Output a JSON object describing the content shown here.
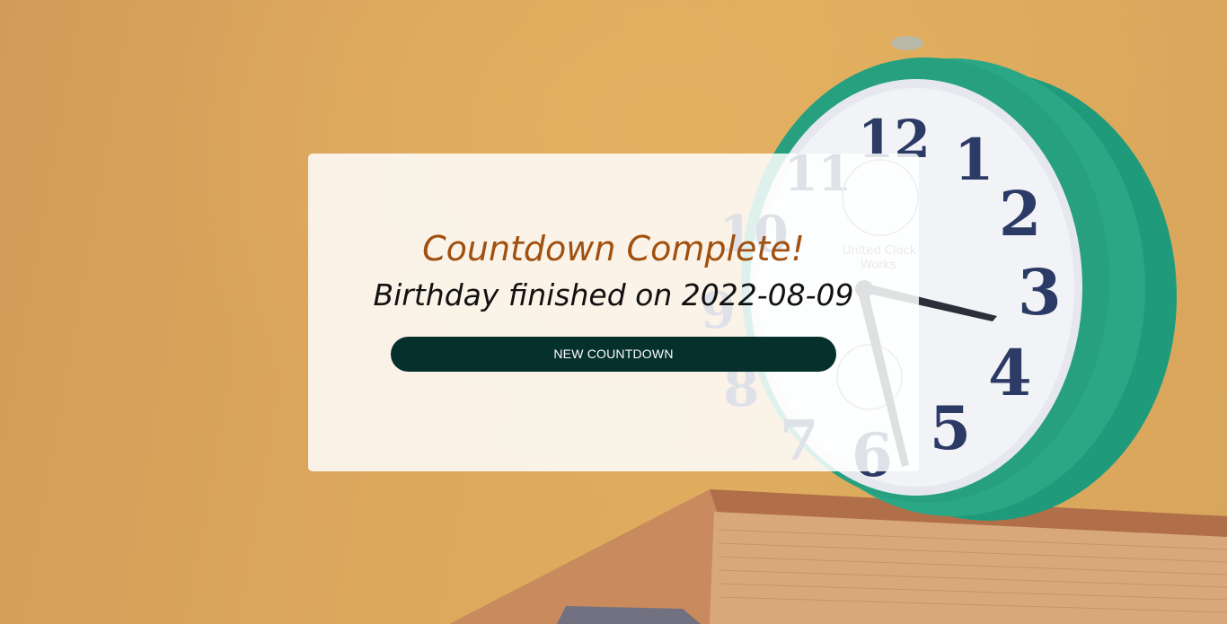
{
  "background": {
    "image_description_icon": "alarm-clock-icon",
    "clock_brand": "United Clock Works",
    "clock_numerals": [
      "12",
      "1",
      "2",
      "3",
      "4",
      "5",
      "6",
      "7",
      "8",
      "9",
      "10",
      "11"
    ]
  },
  "colors": {
    "title": "#a0500f",
    "button_bg": "#06302c",
    "button_text": "#ffffff"
  },
  "result": {
    "title": "Countdown Complete!",
    "message": "Birthday finished on 2022-08-09"
  },
  "actions": {
    "new_countdown_label": "NEW COUNTDOWN"
  }
}
